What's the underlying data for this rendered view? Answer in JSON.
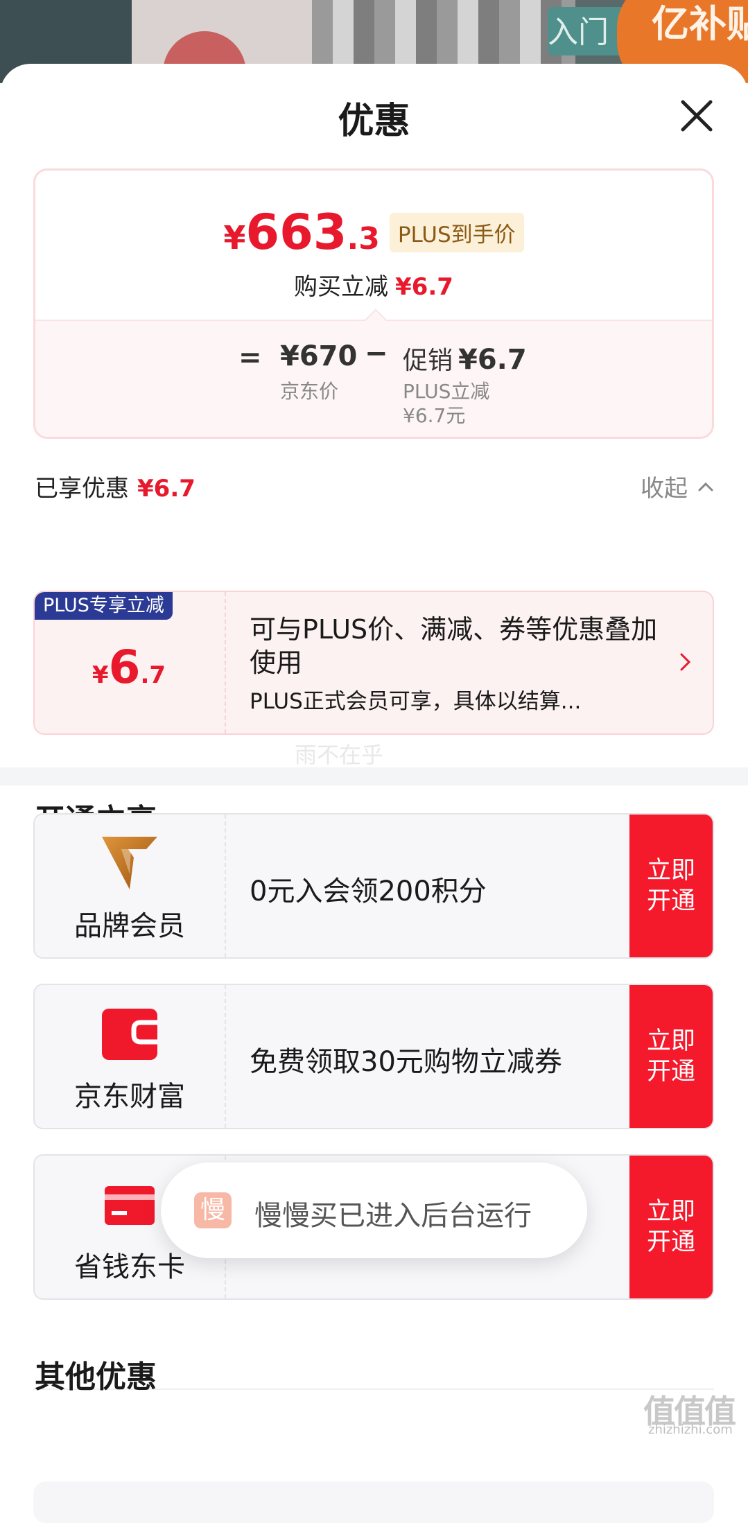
{
  "background": {
    "banner_text": "亿补贴",
    "banner_small": "入门"
  },
  "sheet": {
    "title": "优惠"
  },
  "price_card": {
    "currency": "¥",
    "final_int": "663",
    "final_dec": ".3",
    "plus_tag": "PLUS到手价",
    "reduce_label": "购买立减",
    "reduce_amount": "¥6.7",
    "equals": "=",
    "jd_price": "¥670",
    "jd_price_label": "京东价",
    "minus": "−",
    "promo_label": "促销",
    "promo_amount": "¥6.7",
    "promo_sub1": "PLUS立减",
    "promo_sub2": "¥6.7元"
  },
  "enjoyed": {
    "label": "已享优惠",
    "amount": "¥6.7",
    "collapse_label": "收起"
  },
  "coupon": {
    "badge": "PLUS专享立减",
    "currency": "¥",
    "amount_int": "6",
    "amount_dec": ".7",
    "title": "可与PLUS价、满减、券等优惠叠加使用",
    "note": "PLUS正式会员可享，具体以结算..."
  },
  "watermark": "雨不在乎",
  "open_section": {
    "title": "开通立享",
    "offers": [
      {
        "name": "品牌会员",
        "desc": "0元入会领200积分",
        "button": "立即开通",
        "icon": "brand-v-icon"
      },
      {
        "name": "京东财富",
        "desc": "免费领取30元购物立减券",
        "button": "立即开通",
        "icon": "wallet-icon"
      },
      {
        "name": "省钱东卡",
        "desc": "",
        "button": "立即开通",
        "icon": "card-icon"
      }
    ]
  },
  "toast": {
    "icon_char": "慢",
    "text": "慢慢买已进入后台运行"
  },
  "other_section": {
    "title": "其他优惠"
  },
  "corner_watermark": {
    "main": "值值值",
    "sub": "zhizhizhi.com"
  },
  "colors": {
    "accent_red": "#e8192c",
    "button_red": "#f5192c",
    "plus_blue": "#2b3a94",
    "plus_gold_bg": "#fdf0d8"
  }
}
